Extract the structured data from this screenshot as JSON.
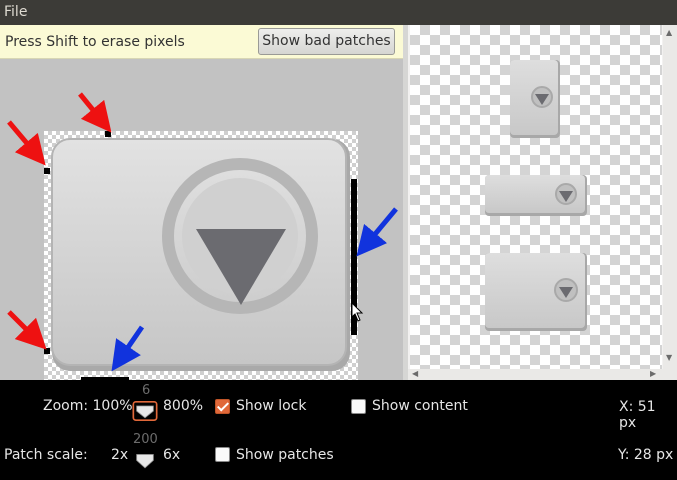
{
  "menubar": {
    "file_label": "File"
  },
  "editor": {
    "hint": "Press Shift to erase pixels",
    "bad_patches_button": "Show bad patches"
  },
  "controls": {
    "zoom_label": "Zoom: 100%",
    "zoom_max": "800%",
    "zoom_value": "6",
    "patch_scale_label": "Patch scale:",
    "patch_scale_min": "2x",
    "patch_scale_max": "6x",
    "patch_scale_value": "200",
    "show_lock_label": "Show lock",
    "show_lock_checked": true,
    "show_content_label": "Show content",
    "show_content_checked": false,
    "show_patches_label": "Show patches",
    "show_patches_checked": false,
    "x_readout": "X: 51 px",
    "y_readout": "Y: 28 px"
  },
  "colors": {
    "accent": "#e0683a",
    "annotation_red": "#ee1111",
    "annotation_blue": "#1133dd"
  }
}
